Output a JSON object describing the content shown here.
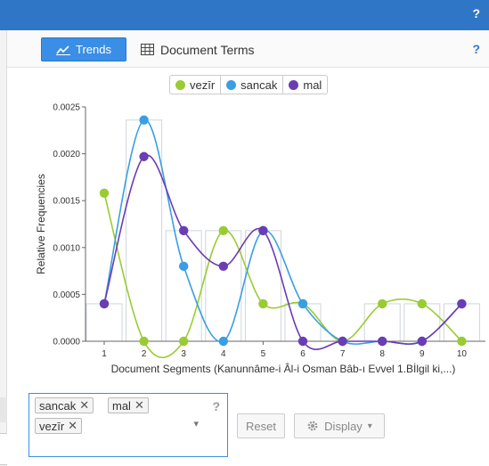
{
  "topbar": {
    "help": "?"
  },
  "tabs": {
    "trends_label": "Trends",
    "document_terms_label": "Document Terms",
    "help": "?"
  },
  "legend": [
    {
      "label": "vezīr",
      "color": "#99cc33"
    },
    {
      "label": "sancak",
      "color": "#3a9ee4"
    },
    {
      "label": "mal",
      "color": "#6a3db5"
    }
  ],
  "terms_input": {
    "tags": [
      "sancak",
      "mal",
      "vezīr"
    ],
    "remove_glyph": "✕",
    "help": "?",
    "dropdown_glyph": "▾"
  },
  "buttons": {
    "reset": "Reset",
    "display": "Display",
    "display_caret": "▾"
  },
  "chart_data": {
    "type": "line",
    "xlabel": "Document Segments (Kanunnâme-i Âl-i Osman Bâb-ı Evvel 1.Bİlgil ki,...)",
    "ylabel": "Relative Frequencies",
    "x": [
      1,
      2,
      3,
      4,
      5,
      6,
      7,
      8,
      9,
      10
    ],
    "ylim": [
      0,
      0.0025
    ],
    "yticks": [
      "0.0000",
      "0.0005",
      "0.0010",
      "0.0015",
      "0.0020",
      "0.0025"
    ],
    "series": [
      {
        "name": "vezīr",
        "color": "#99cc33",
        "values": [
          0.00158,
          0,
          0,
          0.00118,
          0.0004,
          0.0004,
          0,
          0.0004,
          0.0004,
          0
        ]
      },
      {
        "name": "sancak",
        "color": "#3a9ee4",
        "values": [
          0.0004,
          0.00236,
          0.0008,
          0,
          0.00118,
          0.0004,
          0,
          0,
          0,
          0.0004
        ]
      },
      {
        "name": "mal",
        "color": "#6a3db5",
        "values": [
          0.0004,
          0.00197,
          0.00118,
          0.0008,
          0.00118,
          0,
          0,
          0,
          0,
          0.0004
        ]
      }
    ],
    "bars": [
      0.0004,
      0.00236,
      0.00118,
      0.00118,
      0.00118,
      0.0004,
      0,
      0.0004,
      0.0004,
      0.0004
    ],
    "grid": false,
    "legend_position": "top-center"
  }
}
